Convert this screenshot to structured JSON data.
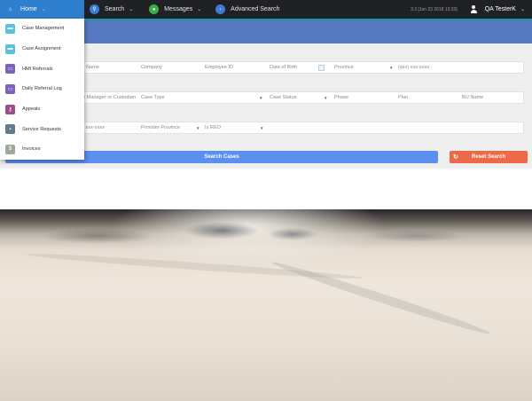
{
  "topbar": {
    "nav": [
      {
        "label": "Home",
        "icon": "home-icon",
        "color": "#2f7fcf"
      },
      {
        "label": "Search",
        "icon": "search-icon",
        "color": "#3d7bd8"
      },
      {
        "label": "Messages",
        "icon": "chat-icon",
        "color": "#3cae48"
      },
      {
        "label": "Advanced Search",
        "icon": "arrow-right-circle-icon",
        "color": "#3d7bd8"
      }
    ],
    "version": "3.3 [Jan 23 2018 13:33]",
    "user": "QA TesterK"
  },
  "home_menu": [
    {
      "label": "Case Management",
      "icon": "folder-icon",
      "color": "#5bc0de"
    },
    {
      "label": "Case Assignment",
      "icon": "folder-icon",
      "color": "#5bc0de"
    },
    {
      "label": "HMI Referrals",
      "icon": "inbox-icon",
      "color": "#7a63b8"
    },
    {
      "label": "Daily Referral Log",
      "icon": "inbox-icon",
      "color": "#7a63b8"
    },
    {
      "label": "Appeals",
      "icon": "key-icon",
      "color": "#9b4f8f"
    },
    {
      "label": "Service Requests",
      "icon": "truck-icon",
      "color": "#607d8b"
    },
    {
      "label": "Invoices",
      "icon": "dollar-icon",
      "color": "#9fa79c"
    }
  ],
  "form": {
    "row1": [
      "Name",
      "Company",
      "Employee ID",
      "Date of Birth",
      "Province",
      "(xxx) xxx-xxxx"
    ],
    "row2": [
      "e Manager or Custodian",
      "Case Type",
      "Case Status",
      "Phase",
      "Plan",
      "BU Name"
    ],
    "row3": [
      ") xxx-xxxx",
      "Provider Province",
      "Is REO"
    ]
  },
  "buttons": {
    "search": "Search Cases",
    "reset": "Reset Search"
  }
}
